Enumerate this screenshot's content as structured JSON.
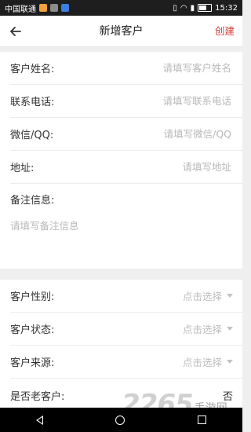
{
  "status_bar": {
    "carrier": "中国联通",
    "time": "15:32"
  },
  "header": {
    "back_icon": "arrow-left-icon",
    "title": "新增客户",
    "create_label": "创建"
  },
  "form": {
    "name": {
      "label": "客户姓名:",
      "placeholder": "请填写客户姓名"
    },
    "phone": {
      "label": "联系电话:",
      "placeholder": "请填写联系电话"
    },
    "wechat": {
      "label": "微信/QQ:",
      "placeholder": "请填写微信/QQ"
    },
    "address": {
      "label": "地址:",
      "placeholder": "请填写地址"
    },
    "notes": {
      "label": "备注信息:",
      "placeholder": "请填写备注信息"
    }
  },
  "selects": {
    "gender": {
      "label": "客户性别:",
      "value": "点击选择"
    },
    "status": {
      "label": "客户状态:",
      "value": "点击选择"
    },
    "source": {
      "label": "客户来源:",
      "value": "点击选择"
    },
    "old_customer": {
      "label": "是否老客户:",
      "value": "否"
    }
  },
  "watermark": {
    "number": "2265",
    "text": "手游网"
  },
  "colors": {
    "accent": "#d03a36",
    "placeholder": "#b8b8b8",
    "background": "#efefef"
  }
}
